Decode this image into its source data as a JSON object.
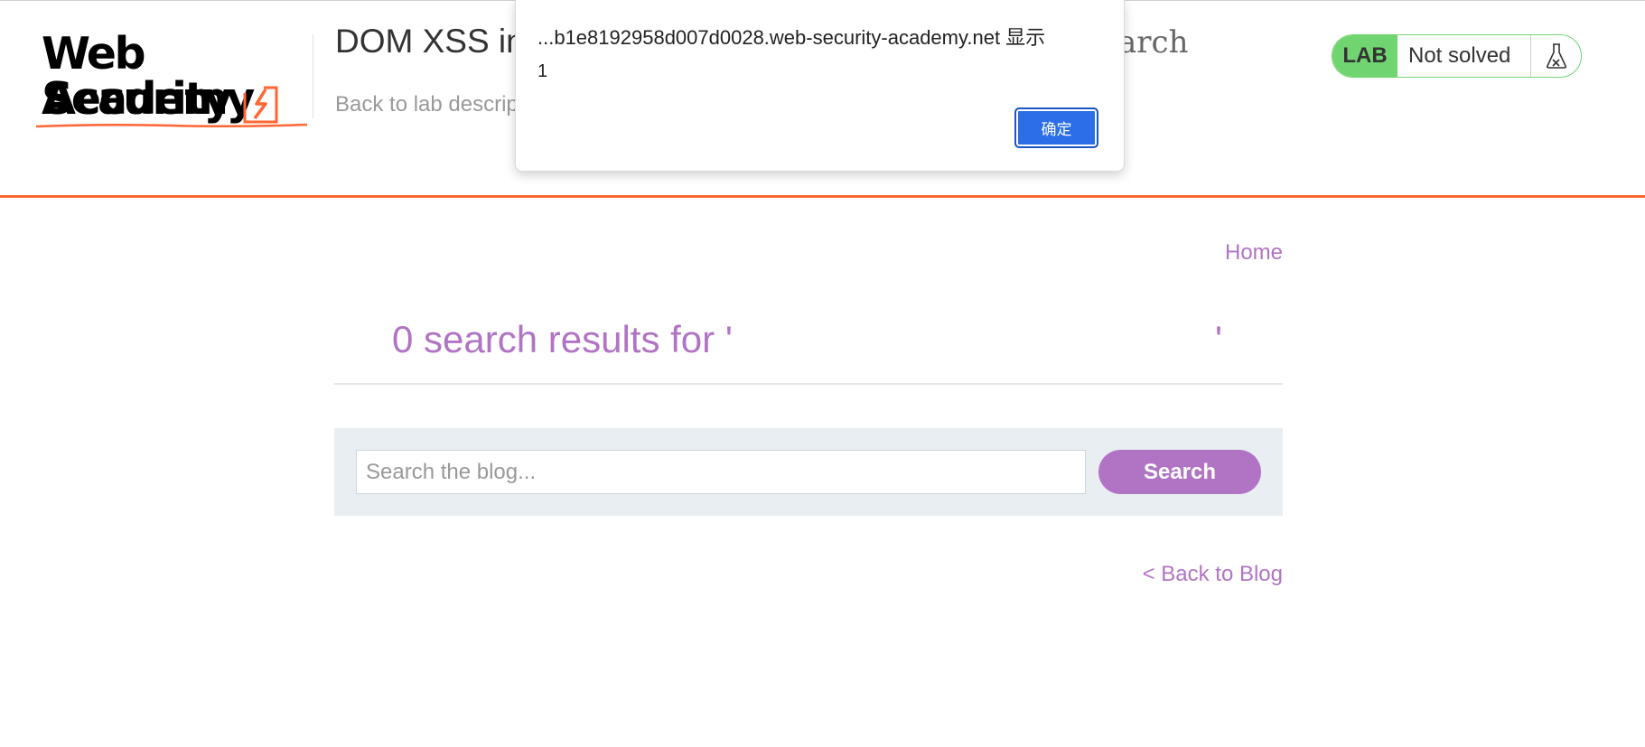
{
  "header": {
    "logo": {
      "line1": "Web Security",
      "line2": "Academy"
    },
    "lab_title": "DOM XSS in",
    "lab_title_tail": "arch",
    "back_to_description": "Back to lab descrip",
    "lab_badge": {
      "label": "LAB",
      "status": "Not solved",
      "icon": "flask-icon"
    }
  },
  "main": {
    "home_link": "Home",
    "results_heading": "0 search results for '",
    "results_heading_end": "'",
    "search": {
      "placeholder": "Search the blog...",
      "value": "",
      "button_label": "Search"
    },
    "back_to_blog": "< Back to Blog"
  },
  "alert": {
    "origin": "...b1e8192958d007d0028.web-security-academy.net 显示",
    "message": "1",
    "ok_label": "确定"
  },
  "colors": {
    "accent_orange": "#ff6633",
    "link_purple": "#b174c4",
    "badge_green": "#70d570",
    "dialog_button_blue": "#2b6ee8"
  }
}
